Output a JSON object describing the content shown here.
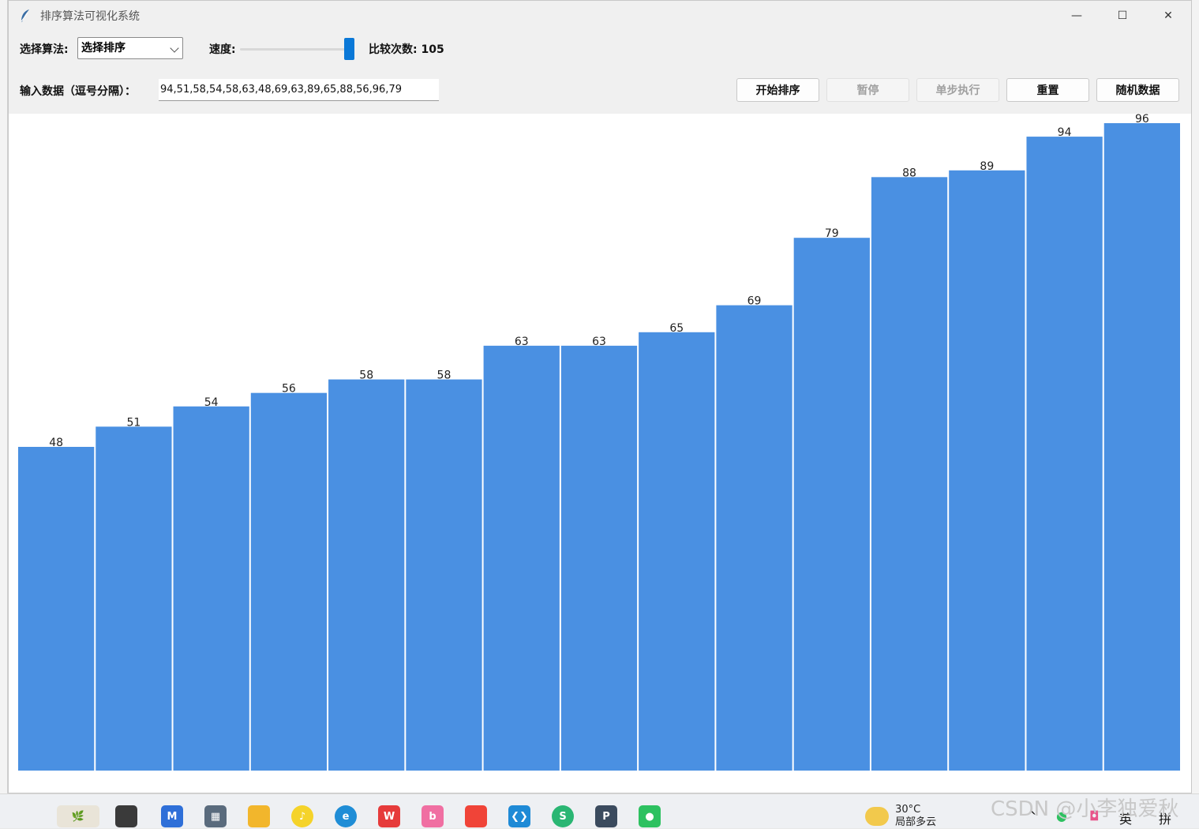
{
  "window": {
    "title": "排序算法可视化系统",
    "controls": {
      "minimize": "—",
      "maximize": "☐",
      "close": "✕"
    }
  },
  "toolbar": {
    "algo_label": "选择算法:",
    "algo_value": "选择排序",
    "speed_label": "速度:",
    "speed_level": 1.0,
    "compare_label": "比较次数: 105",
    "input_label": "输入数据（逗号分隔）：",
    "input_value": "94,51,58,54,58,63,48,69,63,89,65,88,56,96,79",
    "buttons": {
      "start": "开始排序",
      "pause": "暂停",
      "step": "单步执行",
      "reset": "重置",
      "random": "随机数据"
    }
  },
  "chart_data": {
    "type": "bar",
    "values": [
      48,
      51,
      54,
      56,
      58,
      58,
      63,
      63,
      65,
      69,
      79,
      88,
      89,
      94,
      96
    ],
    "ylim": [
      0,
      96
    ],
    "bar_color": "#4a90e2"
  },
  "taskbar": {
    "weather_temp": "30°C",
    "weather_desc": "局部多云",
    "ime_lang": "英",
    "ime_mode": "拼",
    "tray_caret": "^"
  },
  "watermark": "CSDN @小李独爱秋"
}
